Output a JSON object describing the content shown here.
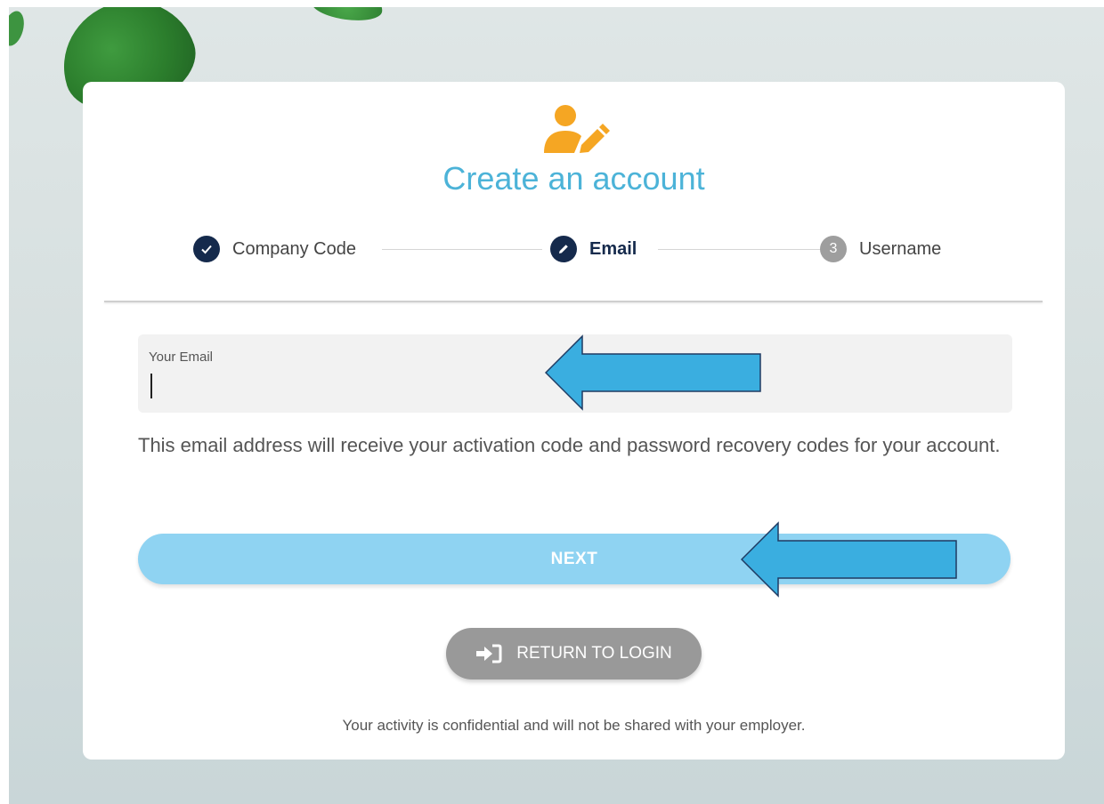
{
  "page": {
    "title": "Create an account",
    "icon": "user-edit-icon",
    "accent_color": "#4cb3d8",
    "icon_color": "#f5a623"
  },
  "stepper": {
    "steps": [
      {
        "label": "Company Code",
        "state": "done",
        "icon": "check-icon"
      },
      {
        "label": "Email",
        "state": "active",
        "icon": "pencil-icon"
      },
      {
        "label": "Username",
        "state": "pending",
        "number": "3"
      }
    ],
    "done_color": "#152a4c",
    "pending_color": "#9e9e9e"
  },
  "form": {
    "email_label": "Your Email",
    "email_value": "",
    "helper_text": "This email address will receive your activation code and password recovery codes for your account."
  },
  "actions": {
    "next_label": "NEXT",
    "next_color": "#8fd3f2",
    "return_label": "RETURN TO LOGIN",
    "return_icon": "sign-in-icon",
    "return_color": "#999999"
  },
  "footer": {
    "note": "Your activity is confidential and will not be shared with your employer."
  },
  "annotations": {
    "arrow_color": "#3aaee0",
    "arrow_icon": "left-arrow-icon"
  }
}
